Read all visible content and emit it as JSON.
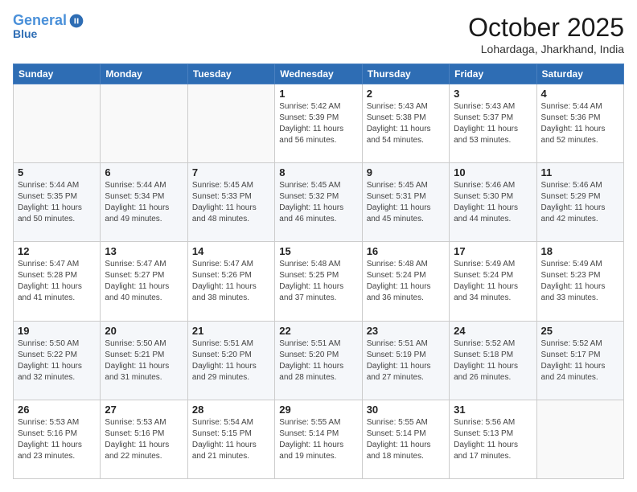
{
  "header": {
    "logo_line1": "General",
    "logo_line2": "Blue",
    "month_title": "October 2025",
    "location": "Lohardaga, Jharkhand, India"
  },
  "weekdays": [
    "Sunday",
    "Monday",
    "Tuesday",
    "Wednesday",
    "Thursday",
    "Friday",
    "Saturday"
  ],
  "weeks": [
    [
      {
        "day": "",
        "info": ""
      },
      {
        "day": "",
        "info": ""
      },
      {
        "day": "",
        "info": ""
      },
      {
        "day": "1",
        "info": "Sunrise: 5:42 AM\nSunset: 5:39 PM\nDaylight: 11 hours\nand 56 minutes."
      },
      {
        "day": "2",
        "info": "Sunrise: 5:43 AM\nSunset: 5:38 PM\nDaylight: 11 hours\nand 54 minutes."
      },
      {
        "day": "3",
        "info": "Sunrise: 5:43 AM\nSunset: 5:37 PM\nDaylight: 11 hours\nand 53 minutes."
      },
      {
        "day": "4",
        "info": "Sunrise: 5:44 AM\nSunset: 5:36 PM\nDaylight: 11 hours\nand 52 minutes."
      }
    ],
    [
      {
        "day": "5",
        "info": "Sunrise: 5:44 AM\nSunset: 5:35 PM\nDaylight: 11 hours\nand 50 minutes."
      },
      {
        "day": "6",
        "info": "Sunrise: 5:44 AM\nSunset: 5:34 PM\nDaylight: 11 hours\nand 49 minutes."
      },
      {
        "day": "7",
        "info": "Sunrise: 5:45 AM\nSunset: 5:33 PM\nDaylight: 11 hours\nand 48 minutes."
      },
      {
        "day": "8",
        "info": "Sunrise: 5:45 AM\nSunset: 5:32 PM\nDaylight: 11 hours\nand 46 minutes."
      },
      {
        "day": "9",
        "info": "Sunrise: 5:45 AM\nSunset: 5:31 PM\nDaylight: 11 hours\nand 45 minutes."
      },
      {
        "day": "10",
        "info": "Sunrise: 5:46 AM\nSunset: 5:30 PM\nDaylight: 11 hours\nand 44 minutes."
      },
      {
        "day": "11",
        "info": "Sunrise: 5:46 AM\nSunset: 5:29 PM\nDaylight: 11 hours\nand 42 minutes."
      }
    ],
    [
      {
        "day": "12",
        "info": "Sunrise: 5:47 AM\nSunset: 5:28 PM\nDaylight: 11 hours\nand 41 minutes."
      },
      {
        "day": "13",
        "info": "Sunrise: 5:47 AM\nSunset: 5:27 PM\nDaylight: 11 hours\nand 40 minutes."
      },
      {
        "day": "14",
        "info": "Sunrise: 5:47 AM\nSunset: 5:26 PM\nDaylight: 11 hours\nand 38 minutes."
      },
      {
        "day": "15",
        "info": "Sunrise: 5:48 AM\nSunset: 5:25 PM\nDaylight: 11 hours\nand 37 minutes."
      },
      {
        "day": "16",
        "info": "Sunrise: 5:48 AM\nSunset: 5:24 PM\nDaylight: 11 hours\nand 36 minutes."
      },
      {
        "day": "17",
        "info": "Sunrise: 5:49 AM\nSunset: 5:24 PM\nDaylight: 11 hours\nand 34 minutes."
      },
      {
        "day": "18",
        "info": "Sunrise: 5:49 AM\nSunset: 5:23 PM\nDaylight: 11 hours\nand 33 minutes."
      }
    ],
    [
      {
        "day": "19",
        "info": "Sunrise: 5:50 AM\nSunset: 5:22 PM\nDaylight: 11 hours\nand 32 minutes."
      },
      {
        "day": "20",
        "info": "Sunrise: 5:50 AM\nSunset: 5:21 PM\nDaylight: 11 hours\nand 31 minutes."
      },
      {
        "day": "21",
        "info": "Sunrise: 5:51 AM\nSunset: 5:20 PM\nDaylight: 11 hours\nand 29 minutes."
      },
      {
        "day": "22",
        "info": "Sunrise: 5:51 AM\nSunset: 5:20 PM\nDaylight: 11 hours\nand 28 minutes."
      },
      {
        "day": "23",
        "info": "Sunrise: 5:51 AM\nSunset: 5:19 PM\nDaylight: 11 hours\nand 27 minutes."
      },
      {
        "day": "24",
        "info": "Sunrise: 5:52 AM\nSunset: 5:18 PM\nDaylight: 11 hours\nand 26 minutes."
      },
      {
        "day": "25",
        "info": "Sunrise: 5:52 AM\nSunset: 5:17 PM\nDaylight: 11 hours\nand 24 minutes."
      }
    ],
    [
      {
        "day": "26",
        "info": "Sunrise: 5:53 AM\nSunset: 5:16 PM\nDaylight: 11 hours\nand 23 minutes."
      },
      {
        "day": "27",
        "info": "Sunrise: 5:53 AM\nSunset: 5:16 PM\nDaylight: 11 hours\nand 22 minutes."
      },
      {
        "day": "28",
        "info": "Sunrise: 5:54 AM\nSunset: 5:15 PM\nDaylight: 11 hours\nand 21 minutes."
      },
      {
        "day": "29",
        "info": "Sunrise: 5:55 AM\nSunset: 5:14 PM\nDaylight: 11 hours\nand 19 minutes."
      },
      {
        "day": "30",
        "info": "Sunrise: 5:55 AM\nSunset: 5:14 PM\nDaylight: 11 hours\nand 18 minutes."
      },
      {
        "day": "31",
        "info": "Sunrise: 5:56 AM\nSunset: 5:13 PM\nDaylight: 11 hours\nand 17 minutes."
      },
      {
        "day": "",
        "info": ""
      }
    ]
  ]
}
